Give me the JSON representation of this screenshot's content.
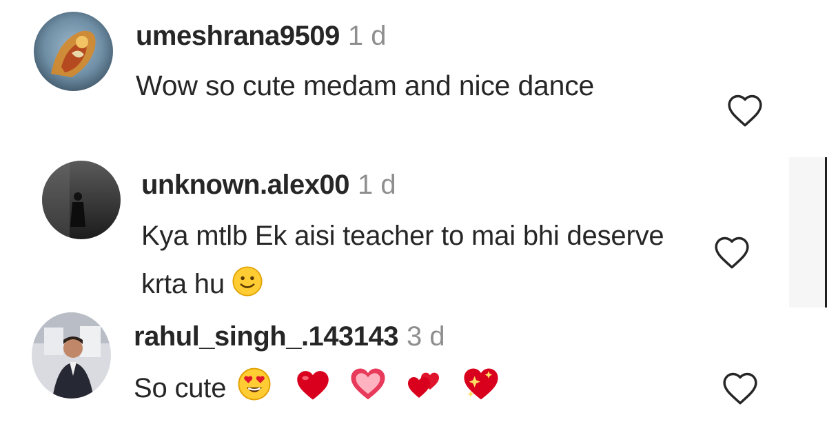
{
  "comments": [
    {
      "username": "umeshrana9509",
      "time": "1 d",
      "text": "Wow so cute medam and nice dance",
      "avatar_icon": "om-symbol-avatar-icon",
      "like_icon": "heart-outline-icon"
    },
    {
      "username": "unknown.alex00",
      "time": "1 d",
      "text": "Kya mtlb Ek aisi teacher to mai bhi deserve krta hu",
      "emojis": [
        "slightly-smiling-face-emoji"
      ],
      "avatar_icon": "person-silhouette-avatar-icon",
      "like_icon": "heart-outline-icon"
    },
    {
      "username": "rahul_singh_.143143",
      "time": "3 d",
      "text": "So cute",
      "emojis": [
        "heart-eyes-emoji",
        "red-heart-emoji",
        "growing-heart-emoji",
        "two-hearts-emoji",
        "sparkling-heart-emoji"
      ],
      "avatar_icon": "man-portrait-avatar-icon",
      "like_icon": "heart-outline-icon"
    }
  ],
  "colors": {
    "text": "#262626",
    "muted": "#8e8e8e",
    "heart_red": "#e0142b"
  }
}
